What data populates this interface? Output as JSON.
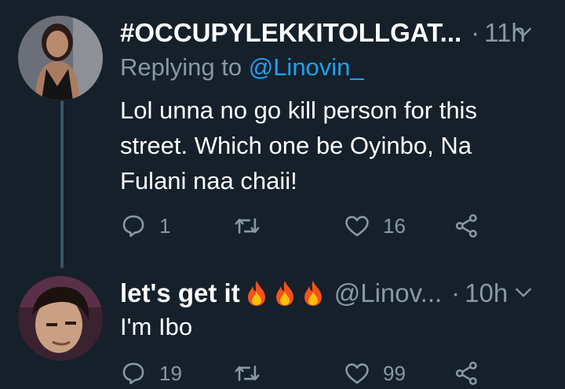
{
  "tweets": [
    {
      "display_name": "#OCCUPYLEKKITOLLGAT...",
      "time": "11h",
      "dot": "·",
      "replying_prefix": "Replying to",
      "replying_to": "@Linovin_",
      "text_lines": [
        "Lol unna no go kill person for this",
        "street. Which one be Oyinbo, Na",
        "Fulani naa chaii!"
      ],
      "replies": "1",
      "retweets": "",
      "likes": "16"
    },
    {
      "display_name": "let's get it",
      "emoji_count": 3,
      "handle": "@Linov...",
      "time": "10h",
      "dot": "·",
      "text_lines": [
        "I'm Ibo"
      ],
      "replies": "19",
      "retweets": "",
      "likes": "99"
    }
  ],
  "colors": {
    "background": "#15202b",
    "text": "#ffffff",
    "secondary": "#8899a6",
    "mention": "#1da1f2",
    "thread_line": "#3d5466"
  },
  "icons": [
    "reply-icon",
    "retweet-icon",
    "like-icon",
    "share-icon",
    "chevron-down-icon",
    "fire-icon"
  ]
}
